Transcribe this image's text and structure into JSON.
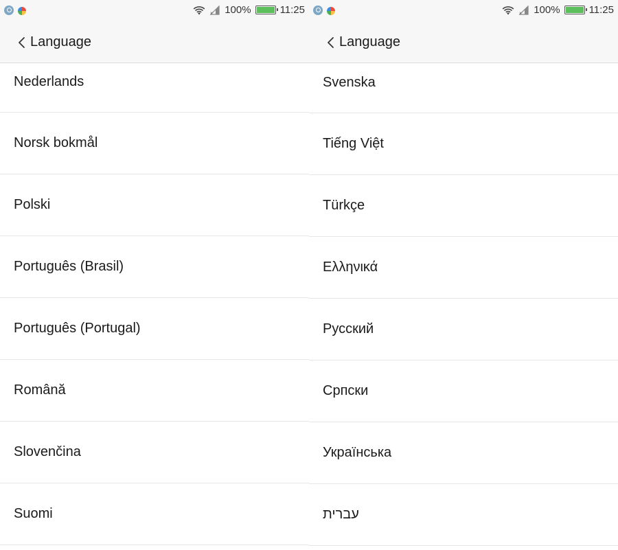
{
  "status_bar": {
    "battery_percent": "100%",
    "time": "11:25",
    "notification_icons": [
      "clock-icon",
      "pinwheel-app-icon"
    ],
    "status_icons": [
      "wifi-icon",
      "cell-signal-icon",
      "battery-icon"
    ],
    "battery_color": "#5cbf5c"
  },
  "left_screen": {
    "title": "Language",
    "items": [
      {
        "label": "Nederlands"
      },
      {
        "label": "Norsk bokmål"
      },
      {
        "label": "Polski"
      },
      {
        "label": "Português (Brasil)"
      },
      {
        "label": "Português (Portugal)"
      },
      {
        "label": "Română"
      },
      {
        "label": "Slovenčina"
      },
      {
        "label": "Suomi"
      }
    ]
  },
  "right_screen": {
    "title": "Language",
    "items": [
      {
        "label": "Svenska"
      },
      {
        "label": "Tiếng Việt"
      },
      {
        "label": "Türkçe"
      },
      {
        "label": "Ελληνικά"
      },
      {
        "label": "Русский"
      },
      {
        "label": "Српски"
      },
      {
        "label": "Українська"
      },
      {
        "label": "עברית"
      }
    ]
  }
}
